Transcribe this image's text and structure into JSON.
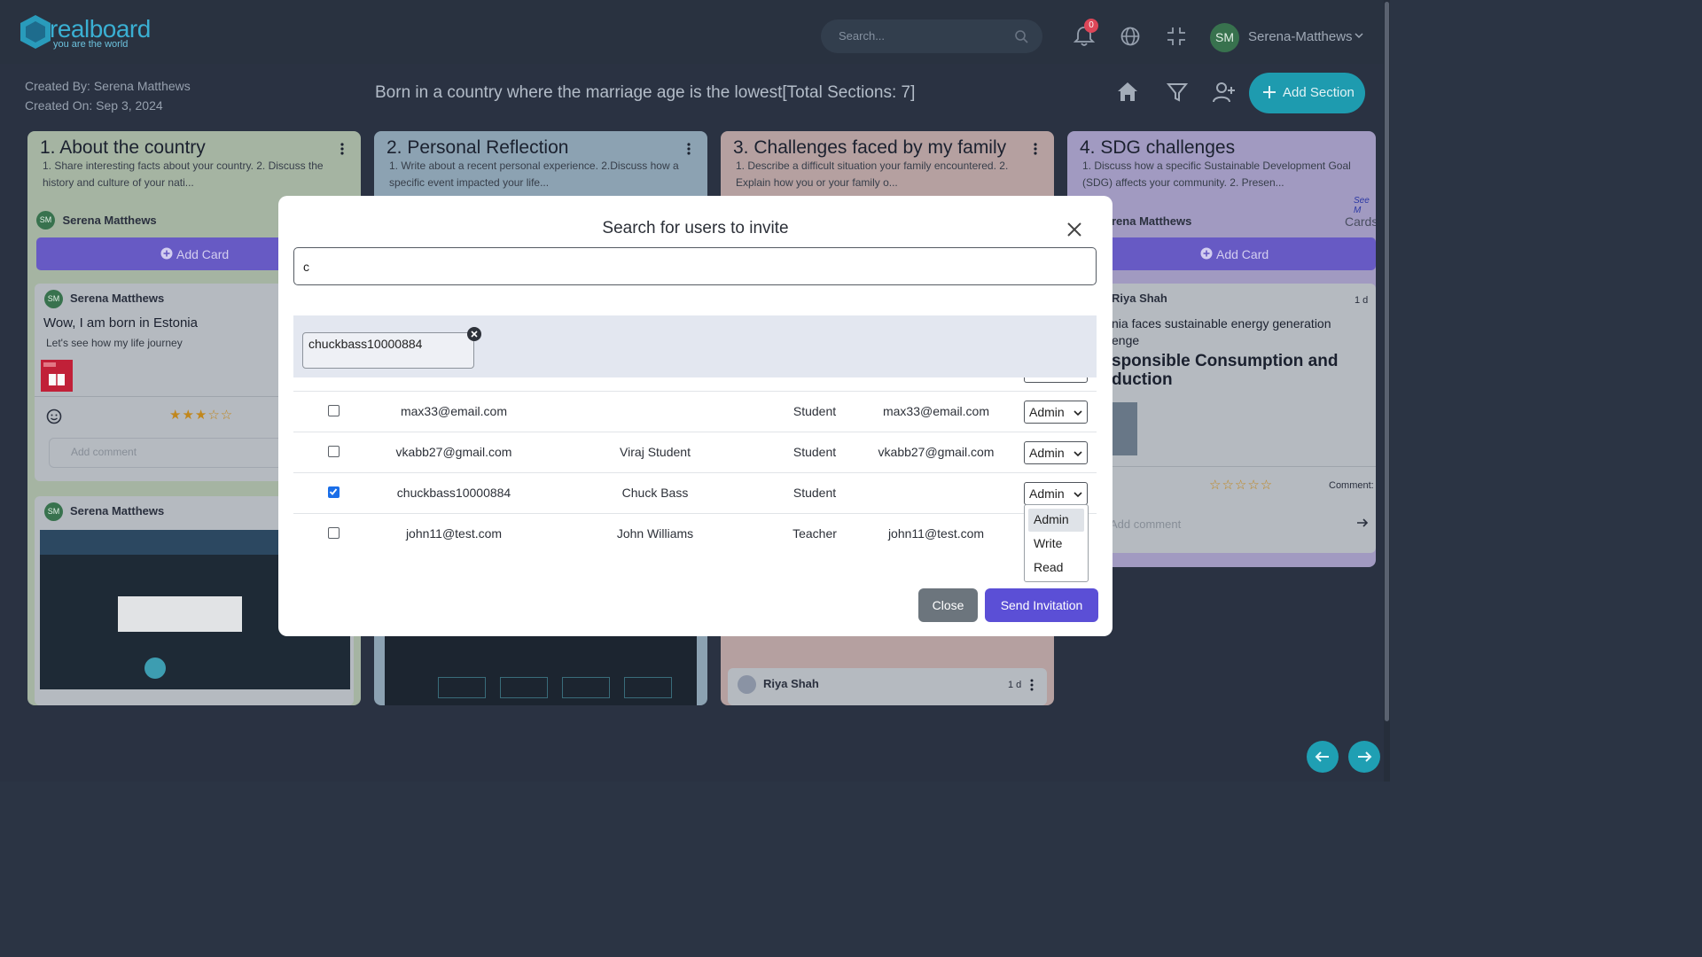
{
  "app": {
    "logo_text": "realboard",
    "logo_tagline": "you are the world",
    "search_placeholder": "Search...",
    "notification_count": "0",
    "user_initials": "SM",
    "user_name": "Serena-Matthews"
  },
  "board": {
    "created_by": "Created By: Serena Matthews",
    "created_on": "Created On: Sep 3, 2024",
    "title": "Born in a country where the marriage age is the lowest[Total Sections: 7]",
    "add_section_label": "Add Section"
  },
  "sections": [
    {
      "title": "1. About the country",
      "desc": "1. Share interesting facts about your country. 2. Discuss the history and culture of your nati...",
      "owner": "Serena Matthews",
      "owner_initials": "SM",
      "add_card": "Add Card",
      "cards": [
        {
          "name": "Serena Matthews",
          "initials": "SM",
          "title": "Wow, I am born in Estonia",
          "sub": "Let's see how my life journey",
          "comment_placeholder": "Add comment",
          "rating": 3
        },
        {
          "name": "Serena Matthews",
          "initials": "SM"
        }
      ]
    },
    {
      "title": "2. Personal Reflection",
      "desc": "1. Write about a recent personal experience. 2.Discuss how a specific event impacted your life..."
    },
    {
      "title": "3. Challenges faced by my family",
      "desc": "1. Describe a difficult situation your family encountered. 2. Explain how you or your family o...",
      "bottom_card": {
        "name": "Riya Shah",
        "time": "1 d"
      }
    },
    {
      "title": "4. SDG challenges",
      "desc": "1. Discuss how a specific Sustainable Development Goal (SDG) affects your community. 2. Presen...",
      "owner_partial": "rena Matthews",
      "see_more": "See M",
      "cards_label": "Cards",
      "add_card": "Add Card",
      "card": {
        "name": "Riya Shah",
        "time": "1 d",
        "text1": "nia faces sustainable energy generation",
        "text2": "enge",
        "heading1": "sponsible Consumption and",
        "heading2": "duction",
        "comments_label": "Comment:",
        "comment_placeholder": "Add comment",
        "rating": 0
      }
    }
  ],
  "modal": {
    "title": "Search for users to invite",
    "search_value": "c",
    "selected_chip": "chuckbass10000884",
    "rows": [
      {
        "username": "max33@email.com",
        "name": "",
        "role": "Student",
        "email": "max33@email.com",
        "permission": "Admin",
        "checked": false
      },
      {
        "username": "vkabb27@gmail.com",
        "name": "Viraj Student",
        "role": "Student",
        "email": "vkabb27@gmail.com",
        "permission": "Admin",
        "checked": false
      },
      {
        "username": "chuckbass10000884",
        "name": "Chuck Bass",
        "role": "Student",
        "email": "",
        "permission": "Admin",
        "checked": true
      },
      {
        "username": "john11@test.com",
        "name": "John Williams",
        "role": "Teacher",
        "email": "john11@test.com",
        "permission": "",
        "checked": false
      }
    ],
    "permission_options": [
      "Admin",
      "Write",
      "Read"
    ],
    "close_label": "Close",
    "send_label": "Send Invitation"
  },
  "colors": {
    "accent": "#1f9fb3",
    "primary_button": "#5b4fd6",
    "section1": "#a9b8a6",
    "section2": "#8fa6b6",
    "section3": "#b9a4a4",
    "section4": "#a59ec5"
  }
}
